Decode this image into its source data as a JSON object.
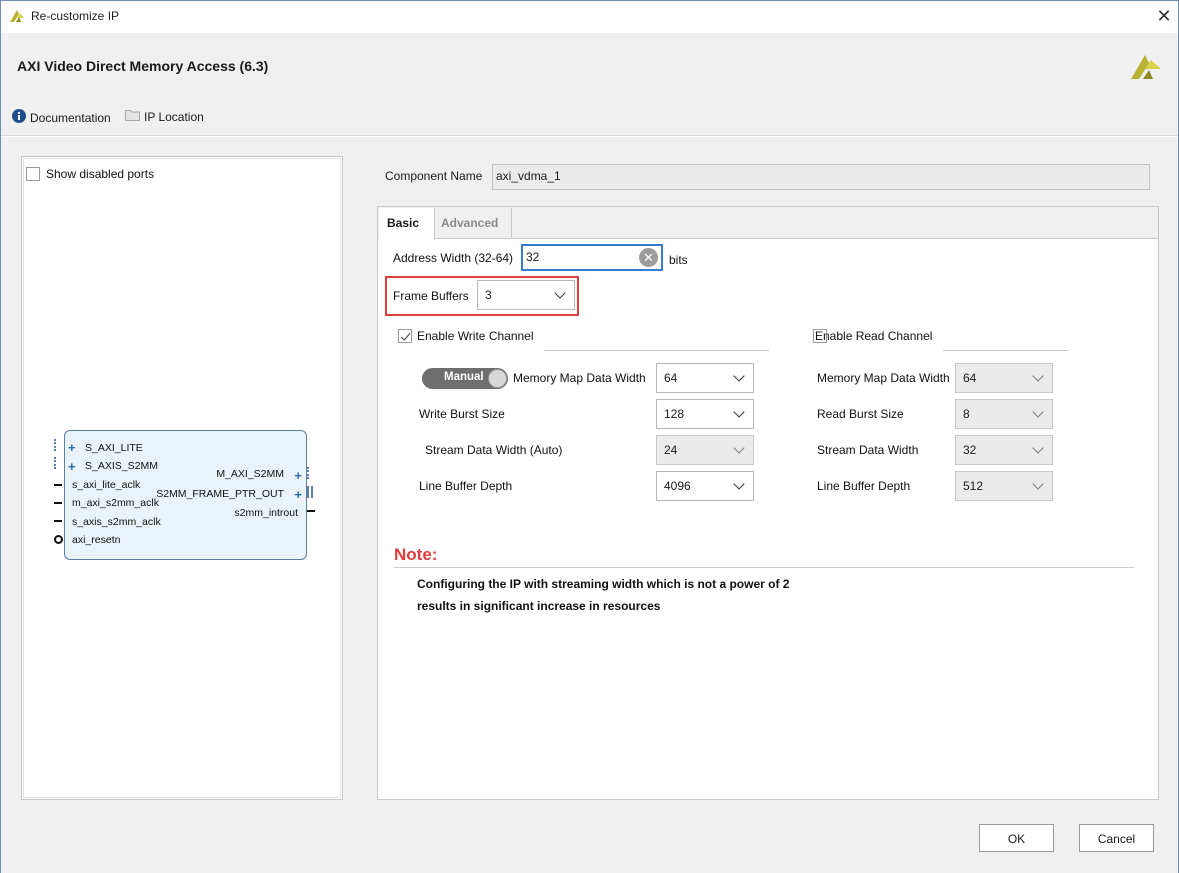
{
  "window": {
    "title": "Re-customize IP",
    "close_label": "✕"
  },
  "header": {
    "ip_title": "AXI Video Direct Memory Access (6.3)",
    "documentation": "Documentation",
    "ip_location": "IP Location"
  },
  "left_panel": {
    "show_disabled_ports": "Show disabled ports",
    "block": {
      "left_ports": [
        "S_AXI_LITE",
        "S_AXIS_S2MM",
        "s_axi_lite_aclk",
        "m_axi_s2mm_aclk",
        "s_axis_s2mm_aclk",
        "axi_resetn"
      ],
      "right_ports": [
        "M_AXI_S2MM",
        "S2MM_FRAME_PTR_OUT",
        "s2mm_introut"
      ]
    }
  },
  "component": {
    "label": "Component Name",
    "value": "axi_vdma_1"
  },
  "tabs": {
    "basic": "Basic",
    "advanced": "Advanced"
  },
  "basic": {
    "address_width_label": "Address Width (32-64)",
    "address_width_value": "32",
    "address_width_unit": "bits",
    "frame_buffers_label": "Frame Buffers",
    "frame_buffers_value": "3",
    "enable_write_label": "Enable Write Channel",
    "enable_write_checked": true,
    "enable_read_label": "Enable Read Channel",
    "enable_read_checked": false,
    "manual_toggle": "Manual",
    "write": {
      "mm_data_width_label": "Memory Map Data Width",
      "mm_data_width_value": "64",
      "burst_size_label": "Write Burst Size",
      "burst_size_value": "128",
      "stream_width_label": "Stream Data Width (Auto)",
      "stream_width_value": "24",
      "line_buffer_label": "Line Buffer Depth",
      "line_buffer_value": "4096"
    },
    "read": {
      "mm_data_width_label": "Memory Map Data Width",
      "mm_data_width_value": "64",
      "burst_size_label": "Read Burst Size",
      "burst_size_value": "8",
      "stream_width_label": "Stream Data Width",
      "stream_width_value": "32",
      "line_buffer_label": "Line Buffer Depth",
      "line_buffer_value": "512"
    },
    "note_title": "Note:",
    "note_line1": "Configuring the IP with streaming width which is not a power of 2",
    "note_line2": "results in significant increase in resources"
  },
  "buttons": {
    "ok": "OK",
    "cancel": "Cancel"
  },
  "colors": {
    "accent_blue": "#3a7bd5",
    "highlight_red": "#e03c3c",
    "logo_yellow": "#c9c23a"
  }
}
